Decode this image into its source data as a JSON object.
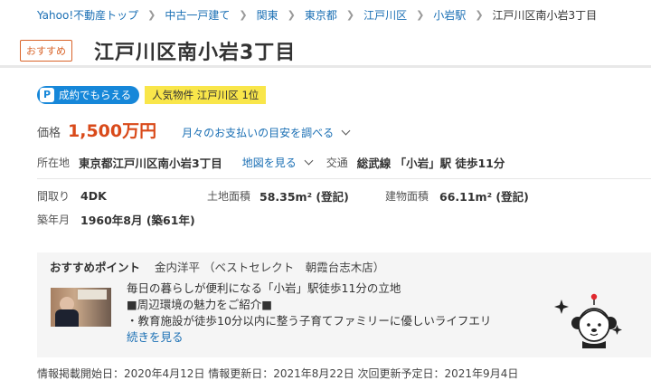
{
  "breadcrumb": {
    "items": [
      "Yahoo!不動産トップ",
      "中古一戸建て",
      "関東",
      "東京都",
      "江戸川区",
      "小岩駅"
    ],
    "current": "江戸川区南小岩3丁目"
  },
  "header": {
    "badge": "おすすめ",
    "title": "江戸川区南小岩3丁目"
  },
  "tags": {
    "paypay_icon": "P",
    "paypay": "成約でもらえる",
    "popular": "人気物件 江戸川区 1位"
  },
  "price": {
    "label": "価格",
    "value": "1,500万円",
    "payment_link": "月々のお支払いの目安を調べる"
  },
  "location": {
    "label": "所在地",
    "value": "東京都江戸川区南小岩3丁目",
    "map_link": "地図を見る",
    "transport_label": "交通",
    "transport_value": "総武線 「小岩」駅 徒歩11分"
  },
  "specs": {
    "layout_label": "間取り",
    "layout_value": "4DK",
    "land_label": "土地面積",
    "land_value": "58.35m² (登記)",
    "building_label": "建物面積",
    "building_value": "66.11m² (登記)",
    "built_label": "築年月",
    "built_value": "1960年8月 (築61年)"
  },
  "recommend": {
    "title": "おすすめポイント",
    "agent": "金内洋平 （ベストセレクト　朝霞台志木店）",
    "lines": [
      "毎日の暮らしが便利になる「小岩」駅徒歩11分の立地",
      "■周辺環境の魅力をご紹介■",
      "・教育施設が徒歩10分以内に整う子育てファミリーに優しいライフエリ"
    ],
    "more": "続きを見る"
  },
  "dates": {
    "text": "情報掲載開始日：2020年4月12日 情報更新日：2021年8月22日 次回更新予定日：2021年9月4日"
  },
  "colors": {
    "accent_orange": "#d9642a",
    "price_red": "#d94a1a",
    "link_blue": "#1a6fb4",
    "paypay_blue": "#1687d9",
    "popular_yellow": "#f9e64a"
  }
}
